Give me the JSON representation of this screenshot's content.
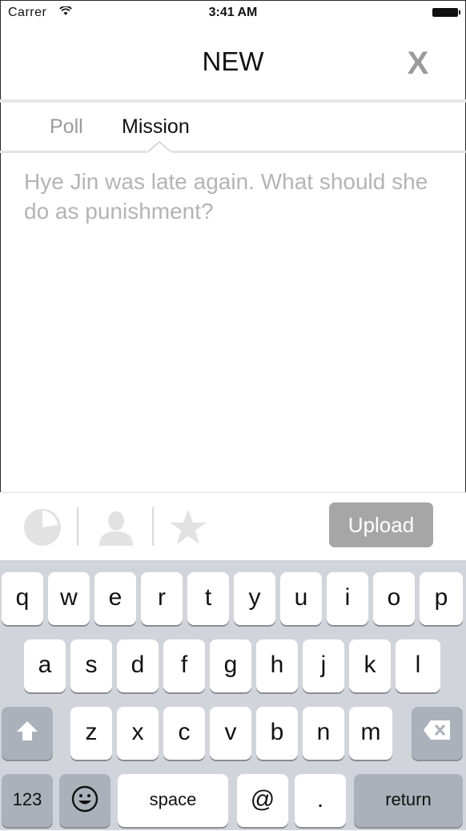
{
  "status_bar": {
    "carrier": "Carrer",
    "time": "3:41 AM"
  },
  "nav": {
    "title": "NEW",
    "close_label": "X"
  },
  "tabs": [
    {
      "label": "Poll",
      "selected": false
    },
    {
      "label": "Mission",
      "selected": true
    }
  ],
  "compose": {
    "placeholder": "Hye Jin was late again. What should she do as punishment?"
  },
  "toolbar": {
    "icons": [
      "pie-chart-icon",
      "user-icon",
      "star-icon"
    ],
    "upload_label": "Upload"
  },
  "keyboard": {
    "row1": [
      "q",
      "w",
      "e",
      "r",
      "t",
      "y",
      "u",
      "i",
      "o",
      "p"
    ],
    "row2": [
      "a",
      "s",
      "d",
      "f",
      "g",
      "h",
      "j",
      "k",
      "l"
    ],
    "row3": [
      "z",
      "x",
      "c",
      "v",
      "b",
      "n",
      "m"
    ],
    "numbers_label": "123",
    "space_label": "space",
    "at_label": "@",
    "period_label": ".",
    "return_label": "return",
    "icons": {
      "shift": "shift-icon",
      "delete": "delete-icon",
      "emoji": "emoji-icon"
    }
  },
  "colors": {
    "accent_gray": "#a6a6a6",
    "keyboard_bg": "#d1d5db",
    "placeholder": "#b4b4b4"
  }
}
